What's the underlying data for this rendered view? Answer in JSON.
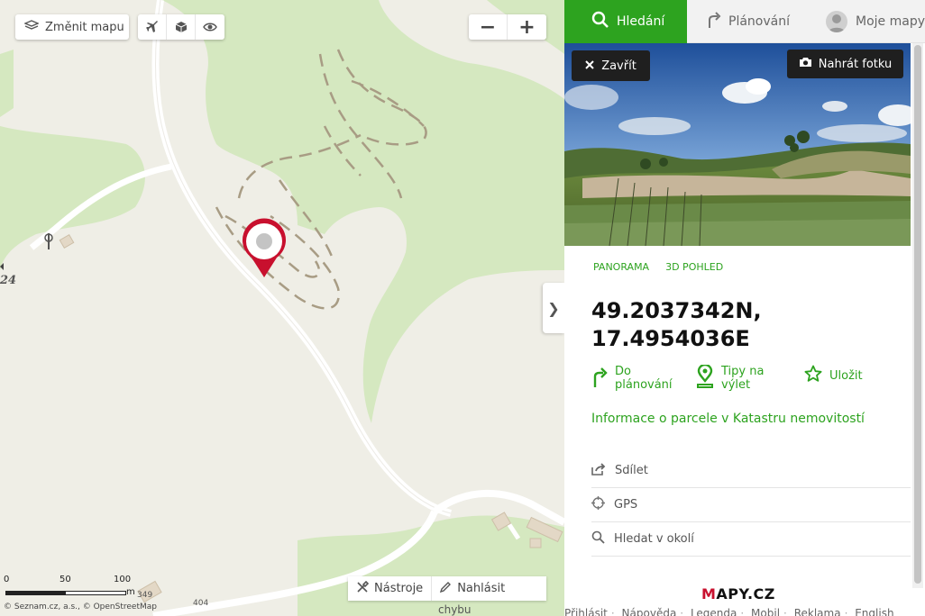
{
  "map": {
    "change_map_label": "Změnit mapu",
    "mode_icons": [
      "airplane-icon",
      "cube-3d-icon",
      "eye-icon"
    ],
    "zoom_out": "−",
    "zoom_in": "+",
    "tools_label": "Nástroje",
    "report_label": "Nahlásit",
    "report_sub": "chybu",
    "collapse_glyph": "❯",
    "scale": {
      "labels": [
        "0",
        "50",
        "100"
      ],
      "unit": "m"
    },
    "attribution": "© Seznam.cz, a.s., © OpenStreetMap",
    "labels": {
      "elevation_left": "24",
      "elevation_b1": "349",
      "elevation_b2": "404"
    }
  },
  "panel": {
    "tabs": [
      {
        "label": "Hledání",
        "icon": "search-icon",
        "active": true
      },
      {
        "label": "Plánování",
        "icon": "route-arrow-icon",
        "active": false
      },
      {
        "label": "Moje mapy",
        "icon": "avatar-icon",
        "active": false
      }
    ],
    "close_label": "Zavřít",
    "upload_label": "Nahrát fotku",
    "view_links": [
      "PANORAMA",
      "3D POHLED"
    ],
    "coords_line1": "49.2037342N,",
    "coords_line2": "17.4954036E",
    "actions": [
      {
        "label_1": "Do",
        "label_2": "plánování",
        "icon": "route-arrow-icon"
      },
      {
        "label_1": "Tipy na",
        "label_2": "výlet",
        "icon": "map-pin-icon"
      },
      {
        "label_1": "Uložit",
        "label_2": "",
        "icon": "star-icon"
      }
    ],
    "cadastre_link": "Informace o parcele v Katastru nemovitostí",
    "list": [
      {
        "label": "Sdílet",
        "icon": "share-icon"
      },
      {
        "label": "GPS",
        "icon": "crosshair-icon"
      },
      {
        "label": "Hledat v okolí",
        "icon": "search-icon"
      }
    ],
    "logo_m": "M",
    "logo_rest": "APY.CZ",
    "footer": [
      "Přihlásit",
      "Nápověda",
      "Legenda",
      "Mobil",
      "Reklama",
      "English"
    ]
  },
  "colors": {
    "accent": "#2da31f",
    "marker": "#c8102e",
    "forest": "#d5e8c0",
    "map_bg": "#efeee6"
  }
}
